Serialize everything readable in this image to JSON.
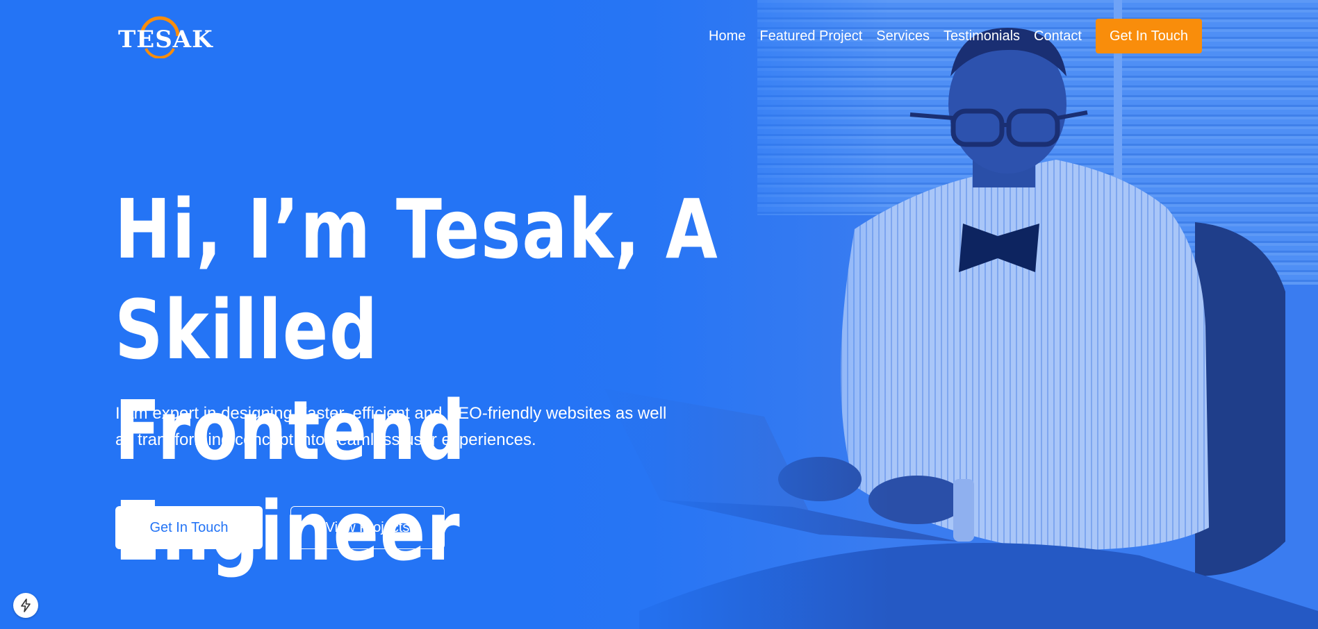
{
  "brand": {
    "logo_text": "TESAK",
    "primary_color": "#2474f5",
    "accent_color": "#f98d0b"
  },
  "nav": {
    "items": [
      {
        "label": "Home"
      },
      {
        "label": "Featured Project"
      },
      {
        "label": "Services"
      },
      {
        "label": "Testimonials"
      },
      {
        "label": "Contact"
      }
    ],
    "cta_label": "Get In Touch"
  },
  "hero": {
    "headline_line1": "Hi, I’m Tesak, A Skilled",
    "headline_line2": "Frontend Engineer",
    "subtitle": "I am expert in designing Faster, efficient and SEO-friendly websites as well as transforming concept into seamless user experiences.",
    "primary_button": "Get In Touch",
    "secondary_button": "View Projects"
  },
  "icons": {
    "corner_badge": "lightning-icon"
  }
}
